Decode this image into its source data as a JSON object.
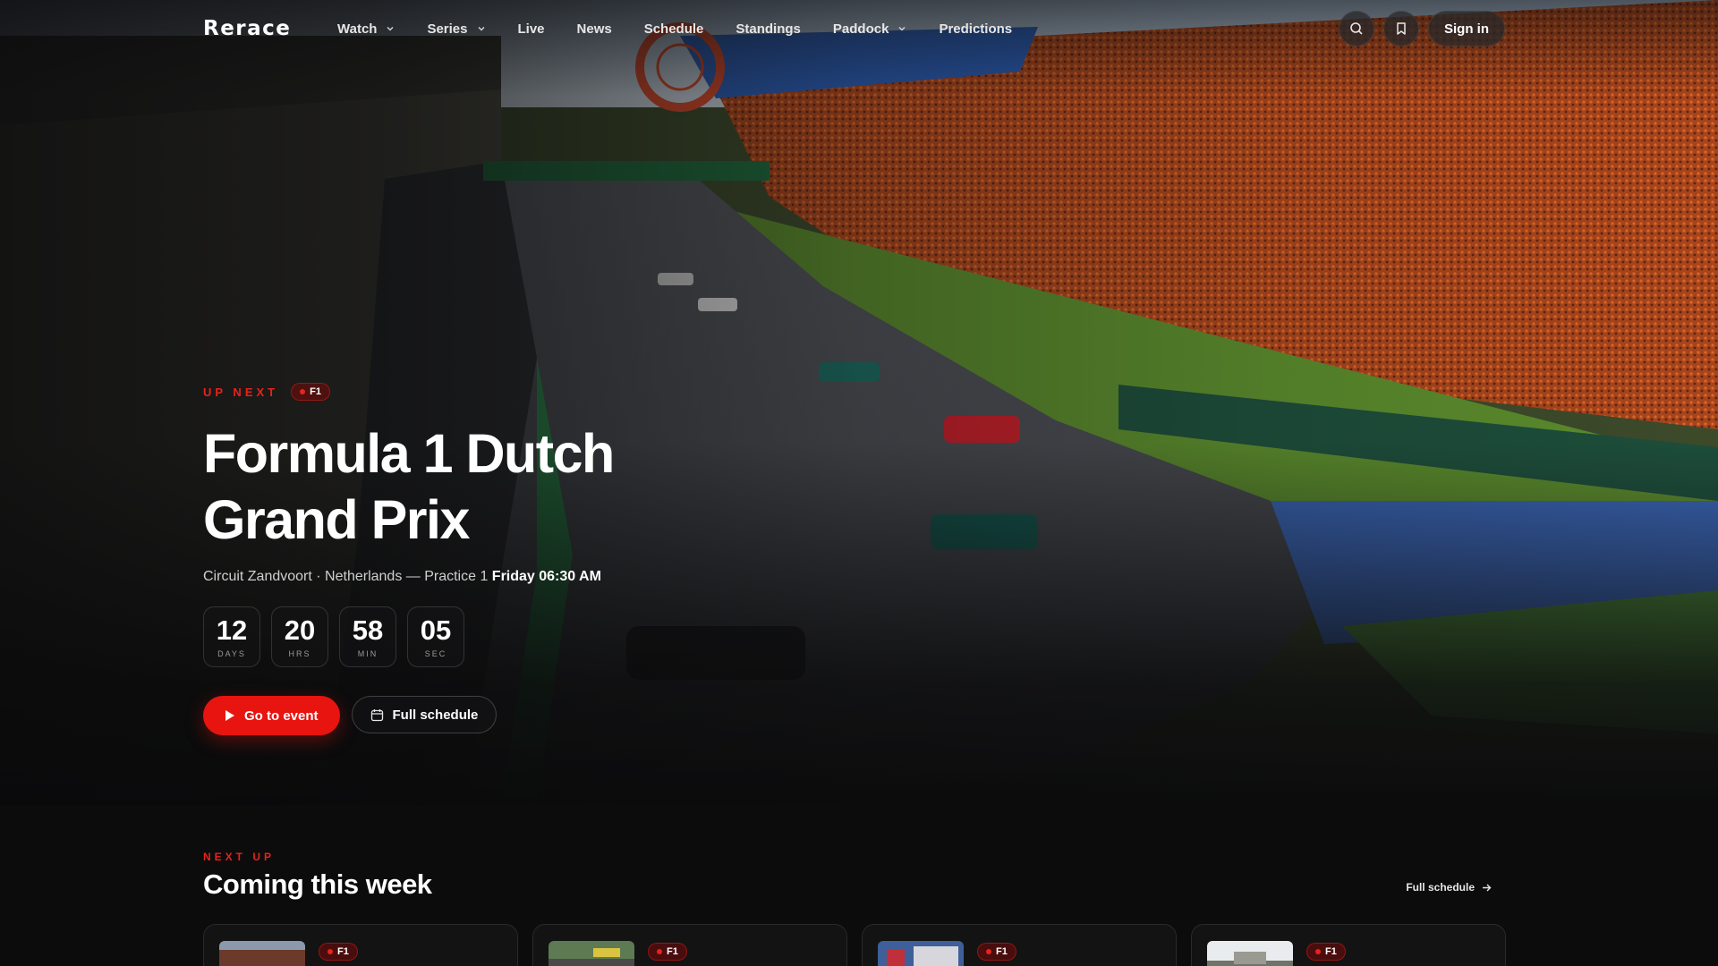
{
  "brand": {
    "name": "Rerace",
    "accent": "#e8221b"
  },
  "nav": {
    "items": [
      {
        "label": "Watch",
        "has_dropdown": true
      },
      {
        "label": "Series",
        "has_dropdown": true
      },
      {
        "label": "Live",
        "has_dropdown": false
      },
      {
        "label": "News",
        "has_dropdown": false
      },
      {
        "label": "Schedule",
        "has_dropdown": false
      },
      {
        "label": "Standings",
        "has_dropdown": false
      },
      {
        "label": "Paddock",
        "has_dropdown": true
      },
      {
        "label": "Predictions",
        "has_dropdown": false
      }
    ],
    "search_icon": "search-icon",
    "bookmark_icon": "bookmark-icon",
    "signin_label": "Sign in"
  },
  "hero": {
    "eyebrow": "UP NEXT",
    "series_badge": "F1",
    "title": "Formula 1 Dutch Grand Prix",
    "location": "Circuit Zandvoort · Netherlands — Practice 1",
    "session_time": "Friday 06:30 AM",
    "countdown": [
      {
        "value": "12",
        "unit": "DAYS"
      },
      {
        "value": "20",
        "unit": "HRS"
      },
      {
        "value": "58",
        "unit": "MIN"
      },
      {
        "value": "05",
        "unit": "SEC"
      }
    ],
    "primary_cta": "Go to event",
    "secondary_cta": "Full schedule"
  },
  "coming": {
    "eyebrow": "NEXT UP",
    "title": "Coming this week",
    "link": "Full schedule",
    "cards": [
      {
        "badge": "F1"
      },
      {
        "badge": "F1"
      },
      {
        "badge": "F1"
      },
      {
        "badge": "F1"
      }
    ]
  }
}
